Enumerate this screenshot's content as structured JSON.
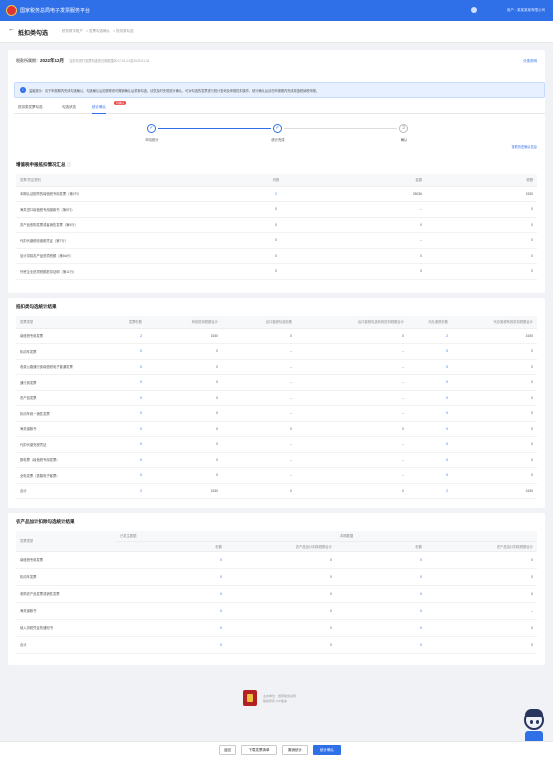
{
  "topbar": {
    "system_name": "国家税务总局电子发票服务平台",
    "user_text": "用户 - 某某某某有限公司"
  },
  "subhead": {
    "back_icon": "arrow-left-icon",
    "title": "抵扣类勾选",
    "breadcrumb": [
      "税务数字账户",
      "发票勾选确认",
      "抵扣类勾选"
    ]
  },
  "header": {
    "label": "税款所属期：",
    "period": "2022年12月",
    "meta": "当前可进行发票勾选的日期范围2017-01-01至2023-01-31",
    "link": "分类说明"
  },
  "notice": {
    "text": "温馨提示：请于申报期内完成勾选确认，勾选确认后如需修改可撤销确认后重新勾选，请您及时完成统计确认，可对勾选的发票进行统计查询及申报抵扣操作，统计确认后请在申报期内完成增值税纳税申报。"
  },
  "tabs": [
    {
      "label": "抵扣类发票勾选"
    },
    {
      "label": "勾选状态"
    },
    {
      "label": "统计确认",
      "badge": "待确认"
    }
  ],
  "steps": [
    {
      "label": "申请统计",
      "state": "done"
    },
    {
      "label": "统计完成",
      "state": "done"
    },
    {
      "label": "确认",
      "state": "todo"
    }
  ],
  "steps_link": "查看历史确认信息",
  "section1": {
    "title": "增值税申报抵扣情况汇总",
    "columns": [
      "发票/凭证类别",
      "份数",
      "金额",
      "税额"
    ],
    "rows": [
      [
        "本期认证相符的增值税专用发票（第2行）",
        "2",
        "25036",
        "1530"
      ],
      [
        "海关进口增值税专用缴款书（第5行）",
        "0",
        "--",
        "0"
      ],
      [
        "农产品收购发票或者销售发票（第6行）",
        "0",
        "0",
        "0"
      ],
      [
        "代扣代缴税收缴款凭证（第7行）",
        "0",
        "--",
        "0"
      ],
      [
        "加计扣除农产品进项税额（第8a行）",
        "0",
        "0",
        "0"
      ],
      [
        "外贸企业进项税额抵扣证明（第11行）",
        "0",
        "0",
        "0"
      ]
    ]
  },
  "section2": {
    "title": "抵扣类勾选统计结果",
    "columns": [
      "发票类型",
      "发票份数",
      "有效抵扣税额合计",
      "出口退税勾选份数",
      "出口退税勾选有效抵扣税额合计",
      "代办退税份数",
      "代办退税有效抵扣税额合计"
    ],
    "rows": [
      [
        "增值税专用发票",
        "2",
        "1530",
        "0",
        "0",
        "2",
        "1530"
      ],
      [
        "机动车发票",
        "0",
        "0",
        "--",
        "--",
        "0",
        "0"
      ],
      [
        "收费公路通行费增值税电子普通发票",
        "0",
        "0",
        "--",
        "--",
        "0",
        "0"
      ],
      [
        "通行费发票",
        "0",
        "0",
        "--",
        "--",
        "0",
        "0"
      ],
      [
        "农产品发票",
        "0",
        "0",
        "--",
        "--",
        "0",
        "0"
      ],
      [
        "机动车统一销售发票",
        "0",
        "0",
        "--",
        "--",
        "0",
        "0"
      ],
      [
        "海关缴款书",
        "0",
        "0",
        "0",
        "0",
        "0",
        "0"
      ],
      [
        "代扣代缴完税凭证",
        "0",
        "0",
        "--",
        "--",
        "0",
        "0"
      ],
      [
        "数电票（增值税专用发票）",
        "0",
        "0",
        "--",
        "--",
        "0",
        "0"
      ],
      [
        "全电发票（铁路电子客票）",
        "0",
        "0",
        "--",
        "--",
        "0",
        "0"
      ],
      [
        "合计",
        "2",
        "1530",
        "0",
        "0",
        "2",
        "1530"
      ]
    ]
  },
  "section3": {
    "title": "农产品加计扣除勾选统计结果",
    "group_headers": [
      "发票类型",
      "已发生数据",
      "本期数据"
    ],
    "sub_columns": [
      "份数",
      "农产品加计扣除税额合计",
      "份数",
      "农产品加计扣除税额合计"
    ],
    "rows": [
      [
        "增值税专用发票",
        "0",
        "0",
        "0",
        "0"
      ],
      [
        "机动车发票",
        "0",
        "0",
        "0",
        "0"
      ],
      [
        "收购农产品发票或销售发票",
        "0",
        "0",
        "0",
        "0"
      ],
      [
        "海关缴款书",
        "0",
        "0",
        "0",
        "--"
      ],
      [
        "纳入扣税凭证的通知书",
        "0",
        "0",
        "0",
        "0"
      ],
      [
        "合计",
        "0",
        "0",
        "0",
        "0"
      ]
    ]
  },
  "footer": {
    "line1": "主办单位：国家税务总局",
    "line2": "版权所有 ICP备案"
  },
  "buttons": [
    {
      "label": "返回"
    },
    {
      "label": "下载发票清单"
    },
    {
      "label": "撤销统计"
    },
    {
      "label": "统计确认",
      "primary": true
    }
  ]
}
